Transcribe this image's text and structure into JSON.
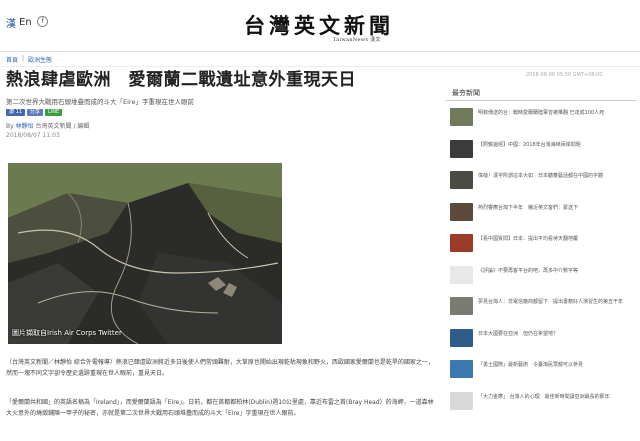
{
  "header": {
    "lang_glyph": "漢",
    "lang_label": "En",
    "fb_icon": "f",
    "logo": "台灣英文新聞",
    "logo_sub": "TaiwanNews 漢文"
  },
  "breadcrumb": [
    "首頁",
    "歐洲生態"
  ],
  "article": {
    "headline": "熱浪肆虐歐洲　愛爾蘭二戰遺址意外重現天日",
    "subhead": "第二次世界大戰用石頭堆疊而成的斗大「Eire」字重現在世人眼前",
    "share": [
      "讚 11",
      "分享",
      "LINE"
    ],
    "byline_prefix": "By",
    "byline_author": "林靜怡",
    "byline_rest": "台灣英文新聞 / 編輯",
    "date": "2018/08/07 11:03",
    "photo_caption": "圖片擷取自Irish Air Corps Twitter",
    "paragraph1": "（台灣英文新聞／林靜怡 綜合外電報導）熱浪已肆虐歐洲將近多日後使人們常頭難耐，大草原也開始出現乾枯現象和野火，西歐國家愛爾蘭也是乾旱的國家之一，然而一塊不同文字卻令歷史遺跡重現在世人眼前，重見天日。",
    "paragraph2_a": "「愛爾蘭共和國」的英語名稱為「Ireland」，而愛爾蘭語為「Eire」。日前，都在首都都柏林(Dublin)週10公里處，靠近布雷之首(Bray Head）的海岬，一道森林大火意外的燒燬鋪陳一甲子的秘密，亦就是第二次世界大戰用石頭堆疊而成的斗大「Eire」字重現在世人眼前。"
  },
  "sidebar": {
    "date": "2018-08-08 05:50 GMT+08:00",
    "title": "最夯新聞",
    "items": [
      {
        "text": "明菲傳送的台：戰時愛爾蘭陸軍曾被推翻 已達成100人死",
        "color": "#6f7a5a"
      },
      {
        "text": "【照鏡邊經】中國：2018年台灣海峽兩岸問題",
        "color": "#3b3b3b"
      },
      {
        "text": "偉哉！漢字所謂這本大如　日本聽蕃藝話都在中國的字體",
        "color": "#4b4b46"
      },
      {
        "text": "熱烈響應台灣下半年　幾近英文客們：蒙送下",
        "color": "#5c4a3a"
      },
      {
        "text": "【看中國質問】日本：提出平均看待天翻地覆",
        "color": "#9c3b2a"
      },
      {
        "text": "《評論》不要再客平台的吧，再多中介數字等",
        "color": "#e8e8e8"
      },
      {
        "text": "夢見台灣人：非電信廠商都留下　提出書籍好人演習生的第五干年",
        "color": "#7a7a72"
      },
      {
        "text": "日本大國要在亞洲　但仍在希望地？",
        "color": "#2f5d8a"
      },
      {
        "text": "「勇士國際」最新藝術　令臺灣民眾都可以參見",
        "color": "#3c78b0"
      },
      {
        "text": "「大力金摩」 台灣人的心理　最佳新時間讓亞洲最長的那年",
        "color": "#d9d9d9"
      }
    ]
  }
}
